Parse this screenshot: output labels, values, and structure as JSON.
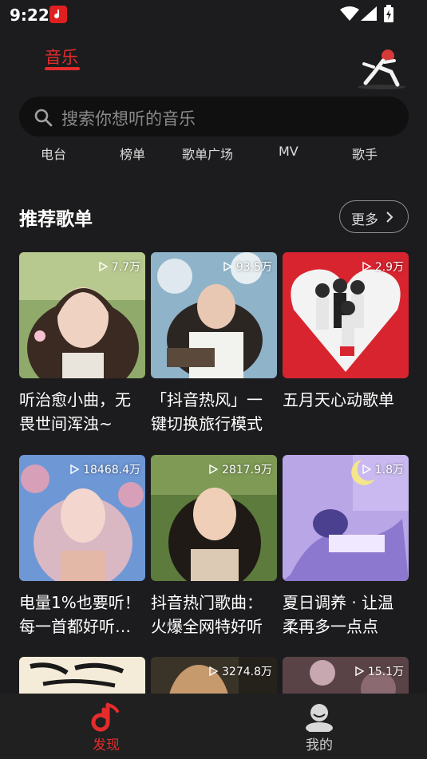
{
  "status_bar": {
    "time": "9:22"
  },
  "header": {
    "tab_label": "音乐"
  },
  "search": {
    "placeholder": "搜索你想听的音乐"
  },
  "categories": [
    "电台",
    "榜单",
    "歌单广场",
    "MV",
    "歌手"
  ],
  "section": {
    "title": "推荐歌单",
    "more_label": "更多"
  },
  "playlists": [
    {
      "title": "听治愈小曲，无畏世间浑浊~",
      "plays": "7.7万"
    },
    {
      "title": "「抖音热风」一键切换旅行模式",
      "plays": "93.5万"
    },
    {
      "title": "五月天心动歌单",
      "plays": "2.9万"
    },
    {
      "title": "电量1%也要听！每一首都好听…",
      "plays": "18468.4万"
    },
    {
      "title": "抖音热门歌曲：火爆全网特好听",
      "plays": "2817.9万"
    },
    {
      "title": "夏日调养 · 让温柔再多一点点",
      "plays": "1.8万"
    },
    {
      "title": "",
      "plays": ""
    },
    {
      "title": "",
      "plays": "3274.8万"
    },
    {
      "title": "",
      "plays": "15.1万"
    }
  ],
  "bottom_nav": [
    {
      "label": "发现",
      "icon": "music-note-icon",
      "active": true
    },
    {
      "label": "我的",
      "icon": "user-icon",
      "active": false
    }
  ],
  "colors": {
    "accent": "#e52c2c",
    "background": "#1c1c1e",
    "search_bg": "#101010"
  }
}
